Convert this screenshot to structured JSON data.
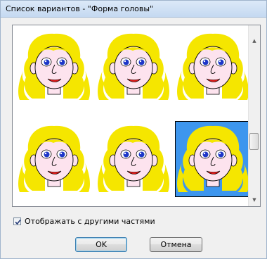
{
  "window": {
    "title": "Список вариантов - \"Форма головы\""
  },
  "variants": [
    {
      "id": 1,
      "selected": false
    },
    {
      "id": 2,
      "selected": false
    },
    {
      "id": 3,
      "selected": false
    },
    {
      "id": 4,
      "selected": false
    },
    {
      "id": 5,
      "selected": false
    },
    {
      "id": 6,
      "selected": true
    }
  ],
  "scrollbar": {
    "up_icon": "arrow-up-icon",
    "down_icon": "arrow-down-icon"
  },
  "options": {
    "show_with_parts_label": "Отображать с другими частями",
    "show_with_parts_checked": true
  },
  "buttons": {
    "ok_label": "OK",
    "cancel_label": "Отмена"
  },
  "colors": {
    "hair": "#f5e600",
    "skin": "#fde3ee",
    "eye": "#1d36c8",
    "mouth": "#e21b1b",
    "selection": "#3d96ee"
  }
}
